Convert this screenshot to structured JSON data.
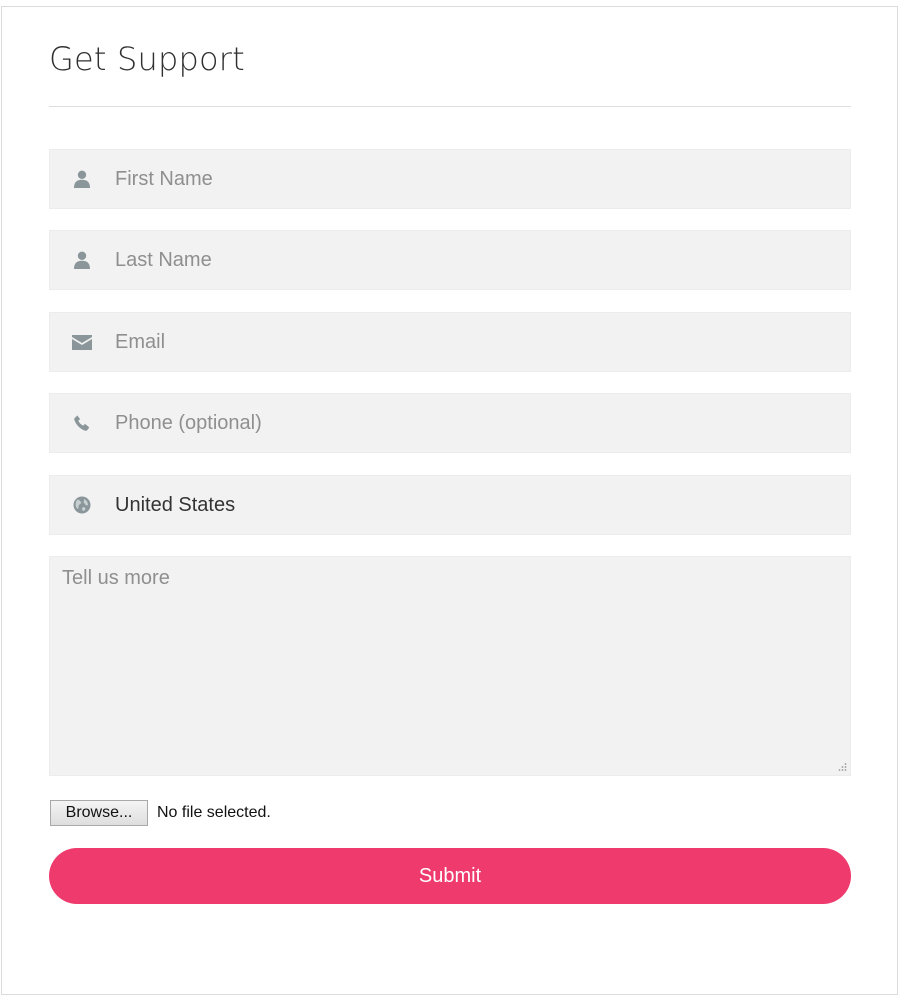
{
  "form": {
    "title": "Get Support",
    "fields": {
      "first_name": {
        "placeholder": "First Name",
        "icon": "user-icon"
      },
      "last_name": {
        "placeholder": "Last Name",
        "icon": "user-icon"
      },
      "email": {
        "placeholder": "Email",
        "icon": "envelope-icon"
      },
      "phone": {
        "placeholder": "Phone (optional)",
        "icon": "phone-icon"
      },
      "country": {
        "value": "United States",
        "icon": "globe-icon"
      }
    },
    "message": {
      "placeholder": "Tell us more"
    },
    "file": {
      "browse_label": "Browse...",
      "status": "No file selected."
    },
    "submit_label": "Submit"
  },
  "colors": {
    "accent": "#ee3a6d",
    "field_bg": "#f2f2f2",
    "icon": "#8a9699",
    "placeholder": "#8f8f8f"
  }
}
